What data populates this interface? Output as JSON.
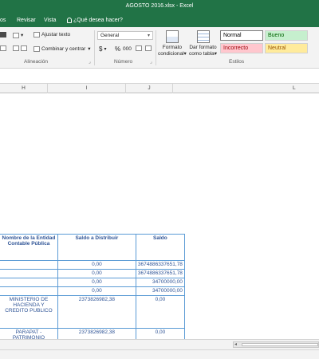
{
  "window": {
    "title": "AGOSTO 2016.xlsx - Excel"
  },
  "tabs": {
    "partial": "os",
    "revisar": "Revisar",
    "vista": "Vista",
    "tellme": "¿Qué desea hacer?"
  },
  "ribbon": {
    "wrap_text": "Ajustar texto",
    "merge_center": "Combinar y centrar",
    "number_format": "General",
    "currency": "$",
    "percent": "%",
    "thousands": "000",
    "conditional_format": [
      "Formato",
      "condicional"
    ],
    "format_as_table": [
      "Dar formato",
      "como tabla"
    ],
    "groups": {
      "alignment": "Alineación",
      "number": "Número",
      "styles": "Estilos"
    },
    "styles": {
      "normal": "Normal",
      "bueno": "Bueno",
      "incorrecto": "Incorrecto",
      "neutral": "Neutral"
    }
  },
  "columns": [
    "H",
    "I",
    "J",
    "L"
  ],
  "table": {
    "headers": [
      "Nombre de la Entidad Contable Pública",
      "Saldo a Distribuir",
      "Saldo"
    ],
    "rows": [
      [
        "",
        "0,00",
        "3674886337651,78"
      ],
      [
        "",
        "0,00",
        "3674886337651,78"
      ],
      [
        "",
        "0,00",
        "34700000,00"
      ],
      [
        "",
        "0,00",
        "34700000,00"
      ],
      [
        "MINISTERIO DE HACIENDA Y CREDITO PUBLICO",
        "2373826982,38",
        "0,00"
      ],
      [
        "PARAPAT - PATRIMONIO AUTONOMO DE REMANENTES DE TELECOMUNICACION",
        "2373826982,38",
        "0,00"
      ]
    ]
  }
}
